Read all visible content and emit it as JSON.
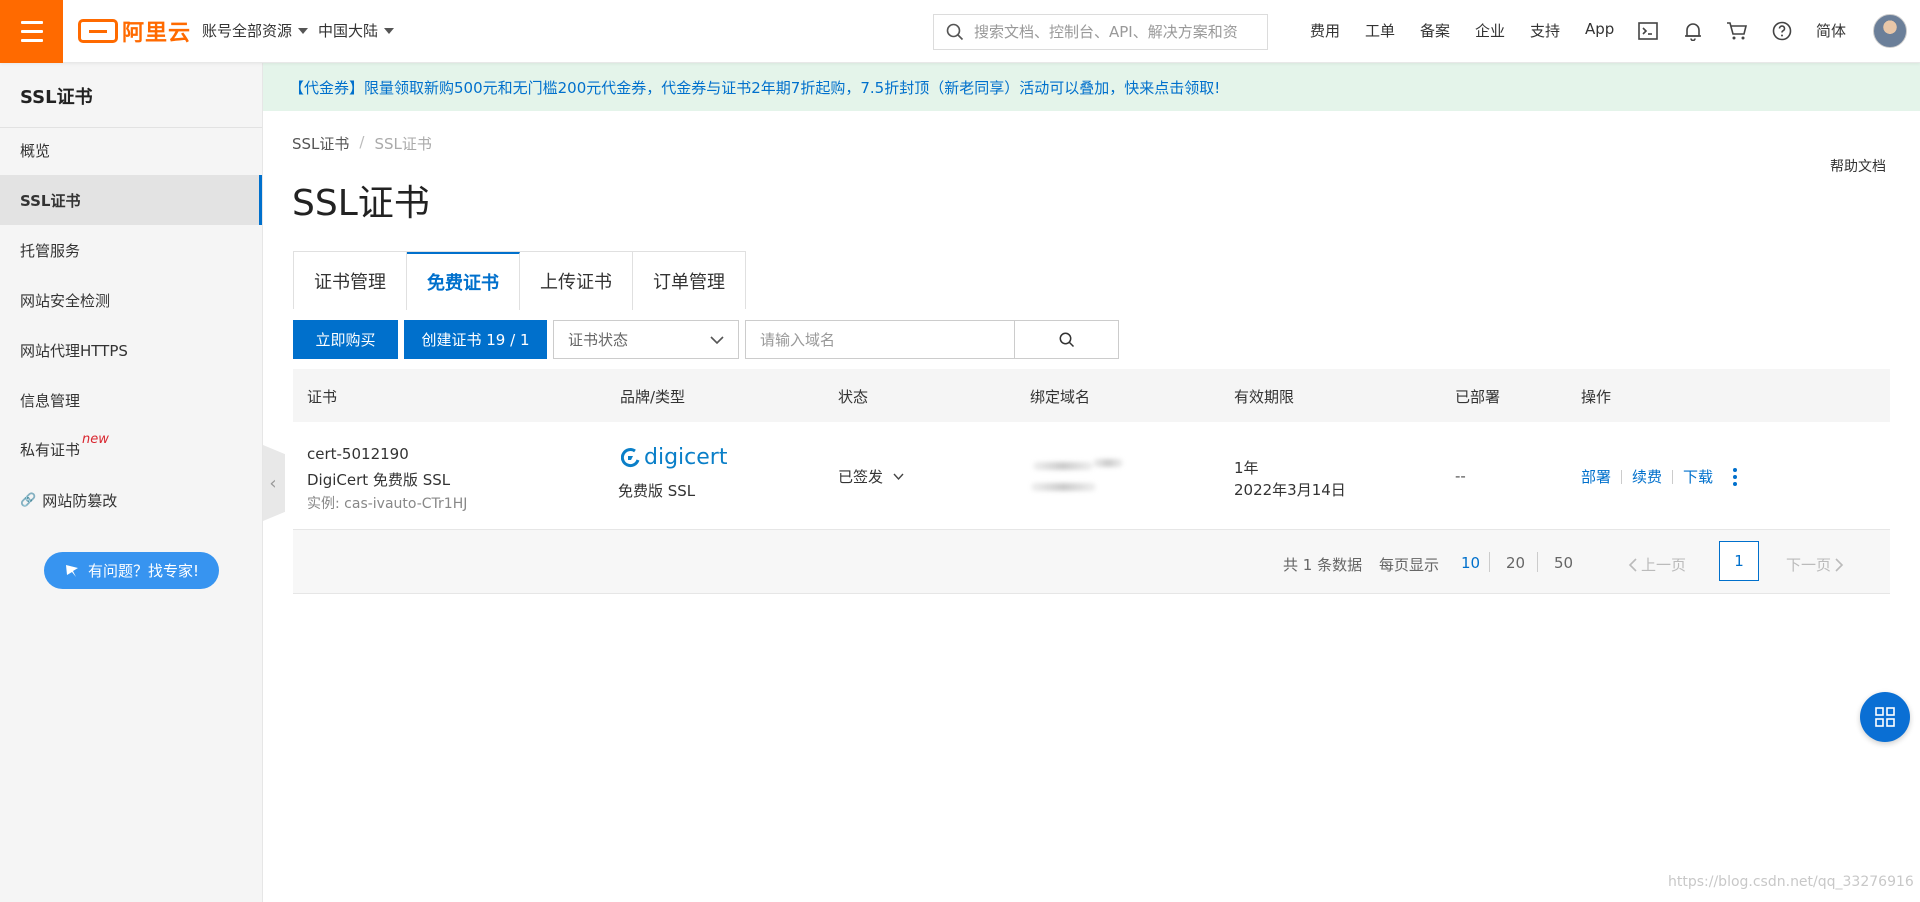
{
  "header": {
    "logo_text": "阿里云",
    "account_menu": "账号全部资源",
    "region_menu": "中国大陆",
    "search_placeholder": "搜索文档、控制台、API、解决方案和资",
    "nav": [
      "费用",
      "工单",
      "备案",
      "企业",
      "支持",
      "App"
    ],
    "lang": "简体"
  },
  "sidebar": {
    "title": "SSL证书",
    "items": [
      {
        "label": "概览"
      },
      {
        "label": "SSL证书"
      },
      {
        "label": "托管服务"
      },
      {
        "label": "网站安全检测"
      },
      {
        "label": "网站代理HTTPS"
      },
      {
        "label": "信息管理"
      },
      {
        "label": "私有证书",
        "tag": "new"
      },
      {
        "label": "网站防篡改"
      }
    ],
    "expert_button": "有问题？找专家!"
  },
  "banner": {
    "text": "【代金券】限量领取新购500元和无门槛200元代金券，代金券与证书2年期7折起购，7.5折封顶（新老同享）活动可以叠加，快来点击领取!"
  },
  "breadcrumb": [
    "SSL证书",
    "/",
    "SSL证书"
  ],
  "help_link": "帮助文档",
  "page_title": "SSL证书",
  "tabs": [
    {
      "label": "证书管理"
    },
    {
      "label": "免费证书"
    },
    {
      "label": "上传证书"
    },
    {
      "label": "订单管理"
    }
  ],
  "toolbar": {
    "buy_label": "立即购买",
    "create_label": "创建证书 19 / 1",
    "status_select": "证书状态",
    "domain_placeholder": "请输入域名"
  },
  "table": {
    "headers": [
      "证书",
      "品牌/类型",
      "状态",
      "绑定域名",
      "有效期限",
      "已部署",
      "操作"
    ],
    "rows": [
      {
        "cert_id": "cert-5012190",
        "cert_type": "DigiCert 免费版 SSL",
        "instance": "实例: cas-ivauto-CTr1HJ",
        "brand_logo": "digicert",
        "brand_type": "免费版 SSL",
        "status": "已签发",
        "validity_period": "1年",
        "validity_date": "2022年3月14日",
        "deployed": "--",
        "ops": [
          "部署",
          "续费",
          "下载"
        ]
      }
    ]
  },
  "pagination": {
    "total": "共 1 条数据",
    "per_page_label": "每页显示",
    "page_sizes": [
      "10",
      "20",
      "50"
    ],
    "prev": "上一页",
    "current": "1",
    "next": "下一页"
  },
  "watermark": "https://blog.csdn.net/qq_33276916",
  "colors": {
    "brand_orange": "#ff6a00",
    "primary_blue": "#0070cc",
    "banner_bg": "#e4f4ea"
  }
}
